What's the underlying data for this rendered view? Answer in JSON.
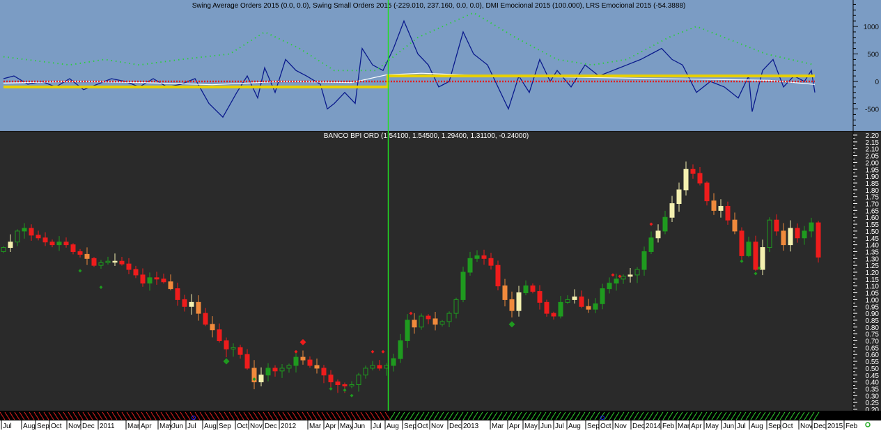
{
  "chart_data": [
    {
      "type": "line",
      "title": "Swing Average Orders 2015 (0.0, 0.0), Swing Small Orders 2015 (-229.010, 237.160, 0.0, 0.0), DMI Emocional 2015 (100.000), LRS Emocional 2015 (-54.3888)",
      "ylim": [
        -850,
        1450
      ],
      "yticks": [
        "1000",
        "500",
        "0",
        "-500"
      ],
      "ytick_values": [
        1000,
        500,
        0,
        -500
      ],
      "x_unit": "week index",
      "series": [
        {
          "name": "Swing Small Orders 2015",
          "color": "#0a1a8c",
          "points": [
            [
              0,
              50
            ],
            [
              1.5,
              100
            ],
            [
              3.5,
              -50
            ],
            [
              5.5,
              0
            ],
            [
              7.5,
              -100
            ],
            [
              9.5,
              50
            ],
            [
              11.5,
              -150
            ],
            [
              13.5,
              -50
            ],
            [
              15.5,
              50
            ],
            [
              17.5,
              0
            ],
            [
              19.5,
              -100
            ],
            [
              21.5,
              50
            ],
            [
              23.5,
              -100
            ],
            [
              25.5,
              -50
            ],
            [
              27.5,
              50
            ],
            [
              29.5,
              -400
            ],
            [
              31.5,
              -650
            ],
            [
              33.5,
              -200
            ],
            [
              35,
              100
            ],
            [
              36.5,
              -300
            ],
            [
              37.5,
              250
            ],
            [
              39,
              -200
            ],
            [
              40.5,
              400
            ],
            [
              42,
              200
            ],
            [
              43.5,
              100
            ],
            [
              45.5,
              -50
            ],
            [
              46.5,
              -500
            ],
            [
              47.5,
              -400
            ],
            [
              49,
              -200
            ],
            [
              50.5,
              -400
            ],
            [
              51.5,
              600
            ],
            [
              53,
              300
            ],
            [
              54.5,
              200
            ],
            [
              56,
              600
            ],
            [
              57.5,
              1100
            ],
            [
              59.5,
              500
            ],
            [
              61,
              300
            ],
            [
              62.5,
              -100
            ],
            [
              64,
              0
            ],
            [
              66,
              900
            ],
            [
              67.5,
              500
            ],
            [
              69.5,
              300
            ],
            [
              71,
              -100
            ],
            [
              72.5,
              -500
            ],
            [
              74,
              100
            ],
            [
              75.5,
              -200
            ],
            [
              77,
              400
            ],
            [
              78.5,
              0
            ],
            [
              79.5,
              200
            ],
            [
              81.5,
              -100
            ],
            [
              83.5,
              300
            ],
            [
              85.5,
              100
            ],
            [
              87.5,
              200
            ],
            [
              89.5,
              300
            ],
            [
              91.5,
              400
            ],
            [
              93,
              500
            ],
            [
              94.5,
              600
            ],
            [
              96,
              400
            ],
            [
              97.5,
              300
            ],
            [
              99.5,
              -200
            ],
            [
              101.5,
              0
            ],
            [
              103.5,
              -100
            ],
            [
              105.5,
              -300
            ],
            [
              107,
              100
            ],
            [
              107.5,
              -550
            ],
            [
              109,
              200
            ],
            [
              110.5,
              400
            ],
            [
              112,
              -100
            ],
            [
              113.5,
              100
            ],
            [
              115,
              0
            ],
            [
              116,
              200
            ],
            [
              116.5,
              -200
            ]
          ]
        },
        {
          "name": "DMI Emocional 2015",
          "color": "#2ecc40",
          "points": [
            [
              0,
              450
            ],
            [
              9.5,
              300
            ],
            [
              14.5,
              400
            ],
            [
              19.5,
              300
            ],
            [
              25.5,
              400
            ],
            [
              32.5,
              500
            ],
            [
              37.5,
              900
            ],
            [
              42.5,
              600
            ],
            [
              47.5,
              200
            ],
            [
              53.5,
              200
            ],
            [
              59.5,
              800
            ],
            [
              67.5,
              1250
            ],
            [
              73.5,
              800
            ],
            [
              79.5,
              400
            ],
            [
              84.5,
              300
            ],
            [
              89.5,
              400
            ],
            [
              95.5,
              800
            ],
            [
              99.5,
              1000
            ],
            [
              105.5,
              700
            ],
            [
              109.5,
              500
            ],
            [
              116.5,
              300
            ]
          ]
        },
        {
          "name": "LRS Emocional 2015",
          "color": "#ffffff",
          "points": [
            [
              0,
              -30
            ],
            [
              10,
              0
            ],
            [
              20,
              -20
            ],
            [
              30,
              -60
            ],
            [
              40,
              0
            ],
            [
              50,
              -20
            ],
            [
              55,
              120
            ],
            [
              60,
              150
            ],
            [
              70,
              100
            ],
            [
              80,
              80
            ],
            [
              90,
              60
            ],
            [
              100,
              40
            ],
            [
              110,
              20
            ],
            [
              116.5,
              -54
            ]
          ]
        },
        {
          "name": "Swing Average Orders 2015",
          "color": "#e8d000",
          "points": [
            [
              0,
              -100
            ],
            [
              55.2,
              -100
            ],
            [
              55.2,
              100
            ],
            [
              116.5,
              100
            ]
          ]
        },
        {
          "name": "zero-line",
          "color": "#e02020",
          "points": [
            [
              0,
              0
            ],
            [
              116.5,
              0
            ]
          ]
        }
      ]
    },
    {
      "type": "candlestick",
      "title": "BANCO BPI ORD (1.54100, 1.54500, 1.29400, 1.31100, -0.24000)",
      "ylim": [
        0.2,
        2.2
      ],
      "yticks": [
        "2.20",
        "2.15",
        "2.10",
        "2.05",
        "2.00",
        "1.95",
        "1.90",
        "1.85",
        "1.80",
        "1.75",
        "1.70",
        "1.65",
        "1.60",
        "1.55",
        "1.50",
        "1.45",
        "1.40",
        "1.35",
        "1.30",
        "1.25",
        "1.20",
        "1.15",
        "1.10",
        "1.05",
        "1.00",
        "0.95",
        "0.90",
        "0.85",
        "0.80",
        "0.75",
        "0.70",
        "0.65",
        "0.60",
        "0.55",
        "0.50",
        "0.45",
        "0.40",
        "0.35",
        "0.30",
        "0.25",
        "0.20"
      ],
      "closes": [
        1.38,
        1.42,
        1.5,
        1.52,
        1.47,
        1.45,
        1.42,
        1.4,
        1.42,
        1.4,
        1.35,
        1.33,
        1.3,
        1.25,
        1.27,
        1.28,
        1.28,
        1.26,
        1.22,
        1.18,
        1.12,
        1.16,
        1.15,
        1.13,
        1.08,
        1.0,
        0.95,
        0.98,
        0.9,
        0.82,
        0.78,
        0.7,
        0.64,
        0.65,
        0.6,
        0.5,
        0.4,
        0.45,
        0.5,
        0.48,
        0.5,
        0.52,
        0.58,
        0.56,
        0.52,
        0.5,
        0.45,
        0.4,
        0.38,
        0.37,
        0.38,
        0.45,
        0.5,
        0.52,
        0.5,
        0.52,
        0.57,
        0.7,
        0.85,
        0.8,
        0.88,
        0.86,
        0.82,
        0.84,
        0.9,
        1.0,
        1.2,
        1.3,
        1.32,
        1.3,
        1.25,
        1.1,
        1.0,
        0.92,
        1.05,
        1.1,
        1.06,
        0.98,
        0.9,
        0.88,
        0.98,
        1.0,
        1.02,
        0.95,
        0.93,
        0.97,
        1.08,
        1.12,
        1.15,
        1.17,
        1.18,
        1.22,
        1.35,
        1.45,
        1.5,
        1.6,
        1.7,
        1.8,
        1.95,
        1.92,
        1.85,
        1.72,
        1.65,
        1.68,
        1.58,
        1.5,
        1.32,
        1.42,
        1.22,
        1.38,
        1.58,
        1.5,
        1.4,
        1.52,
        1.45,
        1.5,
        1.56,
        1.31
      ],
      "buy_signals": [
        [
          11,
          1.21
        ],
        [
          14,
          1.09
        ],
        [
          32,
          0.55
        ],
        [
          36,
          0.42
        ],
        [
          47,
          0.35
        ],
        [
          49,
          0.34
        ],
        [
          50,
          0.3
        ],
        [
          73,
          0.82
        ],
        [
          106,
          1.28
        ],
        [
          108,
          1.19
        ],
        [
          108.5,
          1.23
        ]
      ],
      "sell_signals": [
        [
          42,
          0.62
        ],
        [
          43,
          0.69
        ],
        [
          53,
          0.62
        ],
        [
          54.5,
          0.62
        ],
        [
          58.5,
          0.9
        ],
        [
          87.5,
          1.18
        ],
        [
          88.5,
          1.17
        ],
        [
          93,
          1.55
        ]
      ],
      "x_labels": [
        "Jul",
        "Aug",
        "Sep",
        "Oct",
        "Nov",
        "Dec",
        "2011",
        "Mar",
        "Apr",
        "May",
        "Jun",
        "Jul",
        "Aug",
        "Sep",
        "Oct",
        "Nov",
        "Dec",
        "2012",
        "Mar",
        "Apr",
        "May",
        "Jun",
        "Jul",
        "Aug",
        "Sep",
        "Oct",
        "Nov",
        "Dec",
        "2013",
        "Mar",
        "Apr",
        "May",
        "Jun",
        "Jul",
        "Aug",
        "Sep",
        "Oct",
        "Nov",
        "Dec",
        "2014",
        "Feb",
        "Mar",
        "Apr",
        "May",
        "Jun",
        "Jul",
        "Aug",
        "Sep",
        "Oct",
        "Nov",
        "Dec",
        "2015",
        "Feb"
      ]
    }
  ],
  "colors": {
    "top_bg": "#7b9cc4",
    "bottom_bg": "#2a2a2a",
    "cursor": "#22dd22",
    "up": "#1f9a1f",
    "down": "#ee1c1c",
    "up_light": "#f4f0b0",
    "down_light": "#f08a3c"
  }
}
